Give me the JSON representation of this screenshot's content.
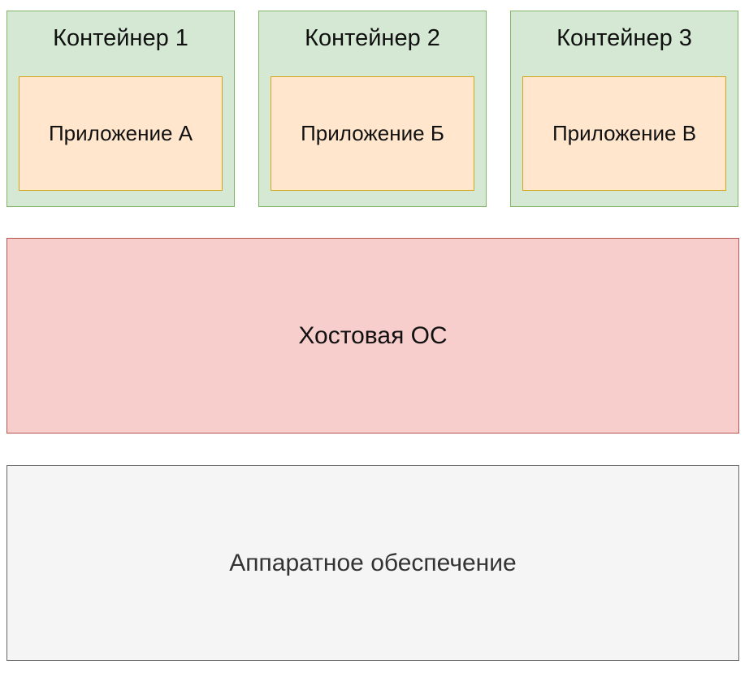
{
  "containers": [
    {
      "title": "Контейнер 1",
      "app": "Приложение А"
    },
    {
      "title": "Контейнер 2",
      "app": "Приложение Б"
    },
    {
      "title": "Контейнер 3",
      "app": "Приложение В"
    }
  ],
  "host_os": {
    "label": "Хостовая ОС"
  },
  "hardware": {
    "label": "Аппаратное обеспечение"
  },
  "colors": {
    "container_fill": "#d5e8d4",
    "container_border": "#82b366",
    "app_fill": "#ffe6cc",
    "app_border": "#d6a619",
    "host_fill": "#f8cecc",
    "host_border": "#b85450",
    "hardware_fill": "#f5f5f5",
    "hardware_border": "#666666"
  }
}
